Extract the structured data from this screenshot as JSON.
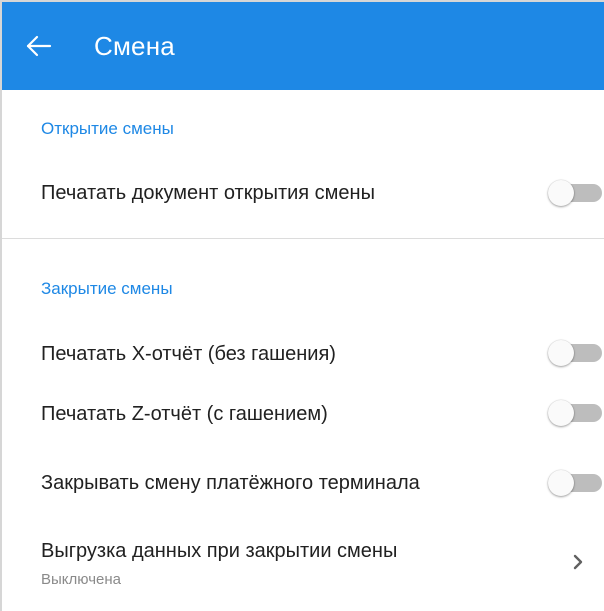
{
  "colors": {
    "app_bar": "#1e88e5",
    "accent": "#1e88e5",
    "switch_off_track": "#bdbdbd",
    "switch_off_thumb": "#fafafa"
  },
  "app_bar": {
    "back_icon": "arrow-left-icon",
    "title": "Смена"
  },
  "sections": [
    {
      "header": "Открытие смены",
      "items": [
        {
          "label": "Печатать документ открытия смены",
          "type": "switch",
          "enabled": false
        }
      ]
    },
    {
      "header": "Закрытие смены",
      "items": [
        {
          "label": "Печатать X-отчёт (без гашения)",
          "type": "switch",
          "enabled": false
        },
        {
          "label": "Печатать Z-отчёт (с гашением)",
          "type": "switch",
          "enabled": false
        },
        {
          "label": "Закрывать смену платёжного терминала",
          "type": "switch",
          "enabled": false
        },
        {
          "label": "Выгрузка данных при закрытии смены",
          "sublabel": "Выключена",
          "type": "navigation",
          "icon": "chevron-right-icon"
        }
      ]
    }
  ]
}
